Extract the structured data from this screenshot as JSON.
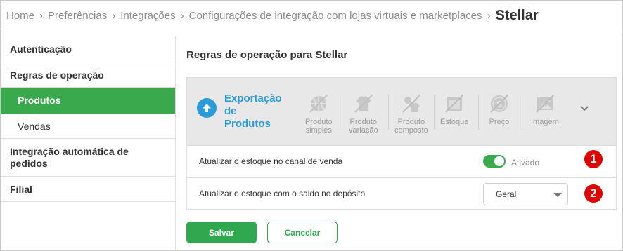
{
  "breadcrumb": {
    "items": [
      "Home",
      "Preferências",
      "Integrações",
      "Configurações de integração com lojas virtuais e marketplaces"
    ],
    "current": "Stellar",
    "separator": "›"
  },
  "sidebar": {
    "items": [
      {
        "label": "Autenticação"
      },
      {
        "label": "Regras de operação"
      },
      {
        "label": "Produtos",
        "active": true
      },
      {
        "label": "Vendas"
      },
      {
        "label": "Integração automática de pedidos"
      },
      {
        "label": "Filial"
      }
    ]
  },
  "main": {
    "title": "Regras de operação para Stellar",
    "export": {
      "line1": "Exportação",
      "line2": "de",
      "line3": "Produtos"
    },
    "tools": [
      {
        "line1": "Produto",
        "line2": "simples",
        "icon": "basketball-icon"
      },
      {
        "line1": "Produto",
        "line2": "variação",
        "icon": "tshirt-icon"
      },
      {
        "line1": "Produto",
        "line2": "composto",
        "icon": "composite-product-icon"
      },
      {
        "line1": "Estoque",
        "line2": "",
        "icon": "stock-icon"
      },
      {
        "line1": "Preço",
        "line2": "",
        "icon": "price-icon"
      },
      {
        "line1": "Imagem",
        "line2": "",
        "icon": "image-icon"
      }
    ],
    "rows": [
      {
        "label": "Atualizar o estoque no canal de venda",
        "toggle_state": "Ativado",
        "badge": "1"
      },
      {
        "label": "Atualizar o estoque com o saldo no depósito",
        "select_value": "Geral",
        "badge": "2"
      }
    ]
  },
  "buttons": {
    "save": "Salvar",
    "cancel": "Cancelar"
  },
  "colors": {
    "accent_green": "#3aa94d",
    "accent_blue": "#2b9ad8",
    "badge_red": "#e00000"
  }
}
